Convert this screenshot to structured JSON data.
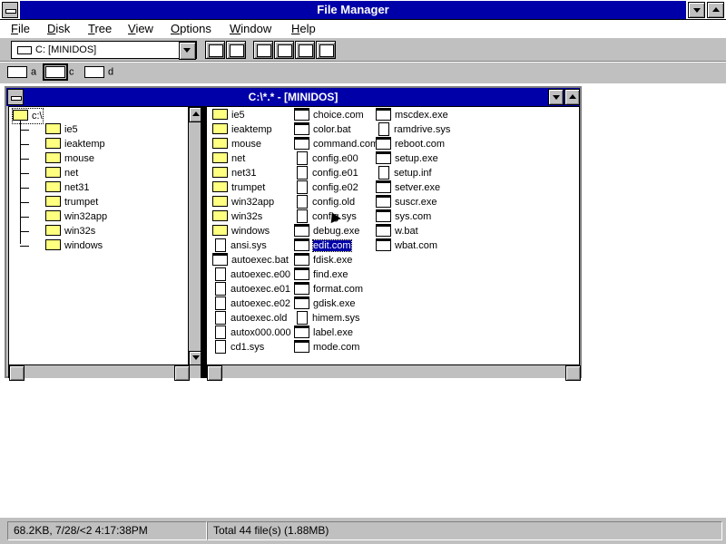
{
  "app": {
    "title": "File Manager"
  },
  "menu": [
    "File",
    "Disk",
    "Tree",
    "View",
    "Options",
    "Window",
    "Help"
  ],
  "toolbar": {
    "drive_combo_value": "C: [MINIDOS]",
    "buttons": [
      "connect-net-drive-icon",
      "disconnect-net-drive-icon",
      "view-name-icon",
      "view-details-icon",
      "sort-name-icon",
      "sort-type-icon",
      "copy-disk-icon",
      "new-window-icon"
    ]
  },
  "drives": [
    {
      "letter": "a",
      "icon": "floppy-drive-icon",
      "selected": false
    },
    {
      "letter": "c",
      "icon": "hard-drive-icon",
      "selected": true
    },
    {
      "letter": "d",
      "icon": "cdrom-drive-icon",
      "selected": false
    }
  ],
  "child_window": {
    "title": "C:\\*.* - [MINIDOS]"
  },
  "tree": {
    "root": "c:\\",
    "folders": [
      "ie5",
      "ieaktemp",
      "mouse",
      "net",
      "net31",
      "trumpet",
      "win32app",
      "win32s",
      "windows"
    ]
  },
  "files": {
    "columns": [
      [
        {
          "name": "ie5",
          "type": "folder"
        },
        {
          "name": "ieaktemp",
          "type": "folder"
        },
        {
          "name": "mouse",
          "type": "folder"
        },
        {
          "name": "net",
          "type": "folder"
        },
        {
          "name": "net31",
          "type": "folder"
        },
        {
          "name": "trumpet",
          "type": "folder"
        },
        {
          "name": "win32app",
          "type": "folder"
        },
        {
          "name": "win32s",
          "type": "folder"
        },
        {
          "name": "windows",
          "type": "folder"
        },
        {
          "name": "ansi.sys",
          "type": "doc"
        },
        {
          "name": "autoexec.bat",
          "type": "prog"
        },
        {
          "name": "autoexec.e00",
          "type": "doc"
        },
        {
          "name": "autoexec.e01",
          "type": "doc"
        },
        {
          "name": "autoexec.e02",
          "type": "doc"
        },
        {
          "name": "autoexec.old",
          "type": "doc"
        },
        {
          "name": "autox000.000",
          "type": "doc"
        },
        {
          "name": "cd1.sys",
          "type": "doc"
        }
      ],
      [
        {
          "name": "choice.com",
          "type": "prog"
        },
        {
          "name": "color.bat",
          "type": "prog"
        },
        {
          "name": "command.com",
          "type": "prog"
        },
        {
          "name": "config.e00",
          "type": "doc"
        },
        {
          "name": "config.e01",
          "type": "doc"
        },
        {
          "name": "config.e02",
          "type": "doc"
        },
        {
          "name": "config.old",
          "type": "doc"
        },
        {
          "name": "config.sys",
          "type": "doc"
        },
        {
          "name": "debug.exe",
          "type": "prog"
        },
        {
          "name": "edit.com",
          "type": "prog",
          "selected": true
        },
        {
          "name": "fdisk.exe",
          "type": "prog"
        },
        {
          "name": "find.exe",
          "type": "prog"
        },
        {
          "name": "format.com",
          "type": "prog"
        },
        {
          "name": "gdisk.exe",
          "type": "prog"
        },
        {
          "name": "himem.sys",
          "type": "doc"
        },
        {
          "name": "label.exe",
          "type": "prog"
        },
        {
          "name": "mode.com",
          "type": "prog"
        }
      ],
      [
        {
          "name": "mscdex.exe",
          "type": "prog"
        },
        {
          "name": "ramdrive.sys",
          "type": "doc"
        },
        {
          "name": "reboot.com",
          "type": "prog"
        },
        {
          "name": "setup.exe",
          "type": "prog"
        },
        {
          "name": "setup.inf",
          "type": "doc"
        },
        {
          "name": "setver.exe",
          "type": "prog"
        },
        {
          "name": "suscr.exe",
          "type": "prog"
        },
        {
          "name": "sys.com",
          "type": "prog"
        },
        {
          "name": "w.bat",
          "type": "prog"
        },
        {
          "name": "wbat.com",
          "type": "prog"
        }
      ]
    ]
  },
  "status": {
    "left": "68.2KB, 7/28/<2 4:17:38PM",
    "right": "Total 44 file(s) (1.88MB)"
  }
}
